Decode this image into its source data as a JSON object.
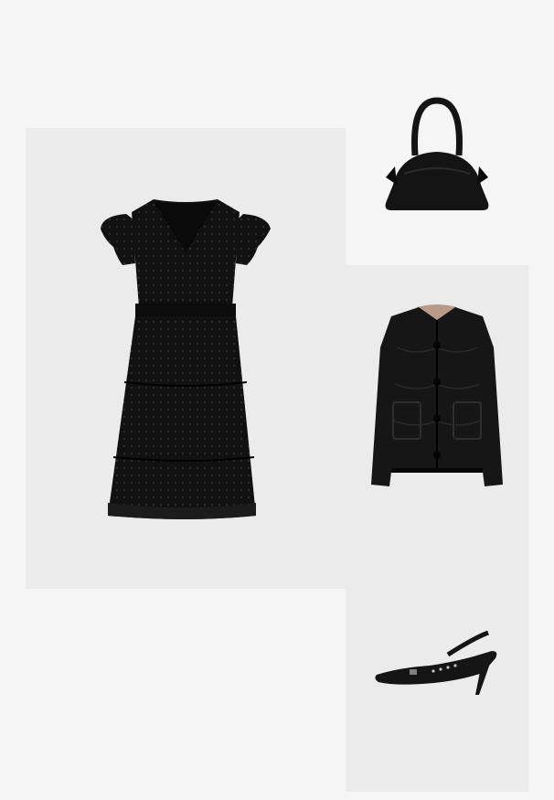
{
  "outfit": {
    "items": [
      {
        "kind": "dress",
        "icon": "lace-dress-icon",
        "color": "#111111"
      },
      {
        "kind": "bag",
        "icon": "handbag-icon",
        "color": "#141414"
      },
      {
        "kind": "jacket",
        "icon": "quilted-jacket-icon",
        "color": "#161616"
      },
      {
        "kind": "shoe",
        "icon": "slingback-pump-icon",
        "color": "#151515"
      }
    ],
    "background_color": "#f5f5f5",
    "tile_color": "#ebebeb"
  }
}
